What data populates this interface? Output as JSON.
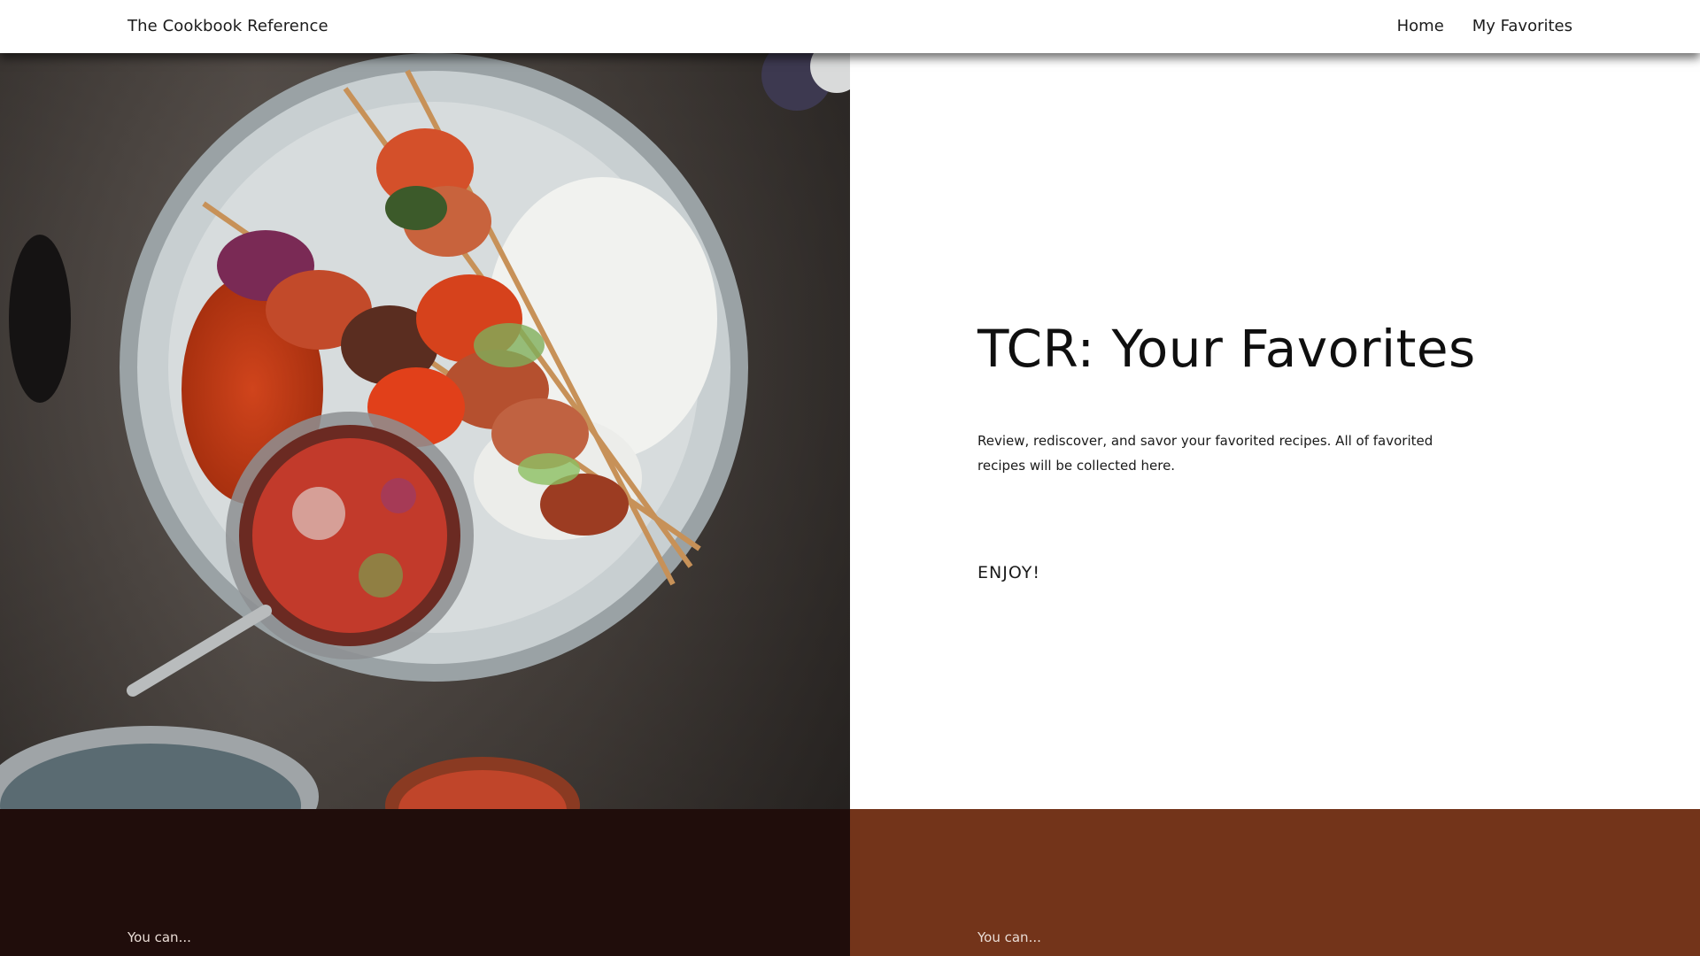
{
  "header": {
    "brand": "The Cookbook Reference",
    "nav": [
      {
        "label": "Home"
      },
      {
        "label": "My Favorites"
      }
    ]
  },
  "hero": {
    "image_icon": "food-photo-skewers",
    "title": "TCR: Your Favorites",
    "description": "Review, rediscover, and savor your favorited recipes. All of favorited recipes will be collected here.",
    "tagline": "ENJOY!"
  },
  "bands": [
    {
      "label": "You can...",
      "color": "#200d0b"
    },
    {
      "label": "You can...",
      "color": "#73341a"
    }
  ]
}
